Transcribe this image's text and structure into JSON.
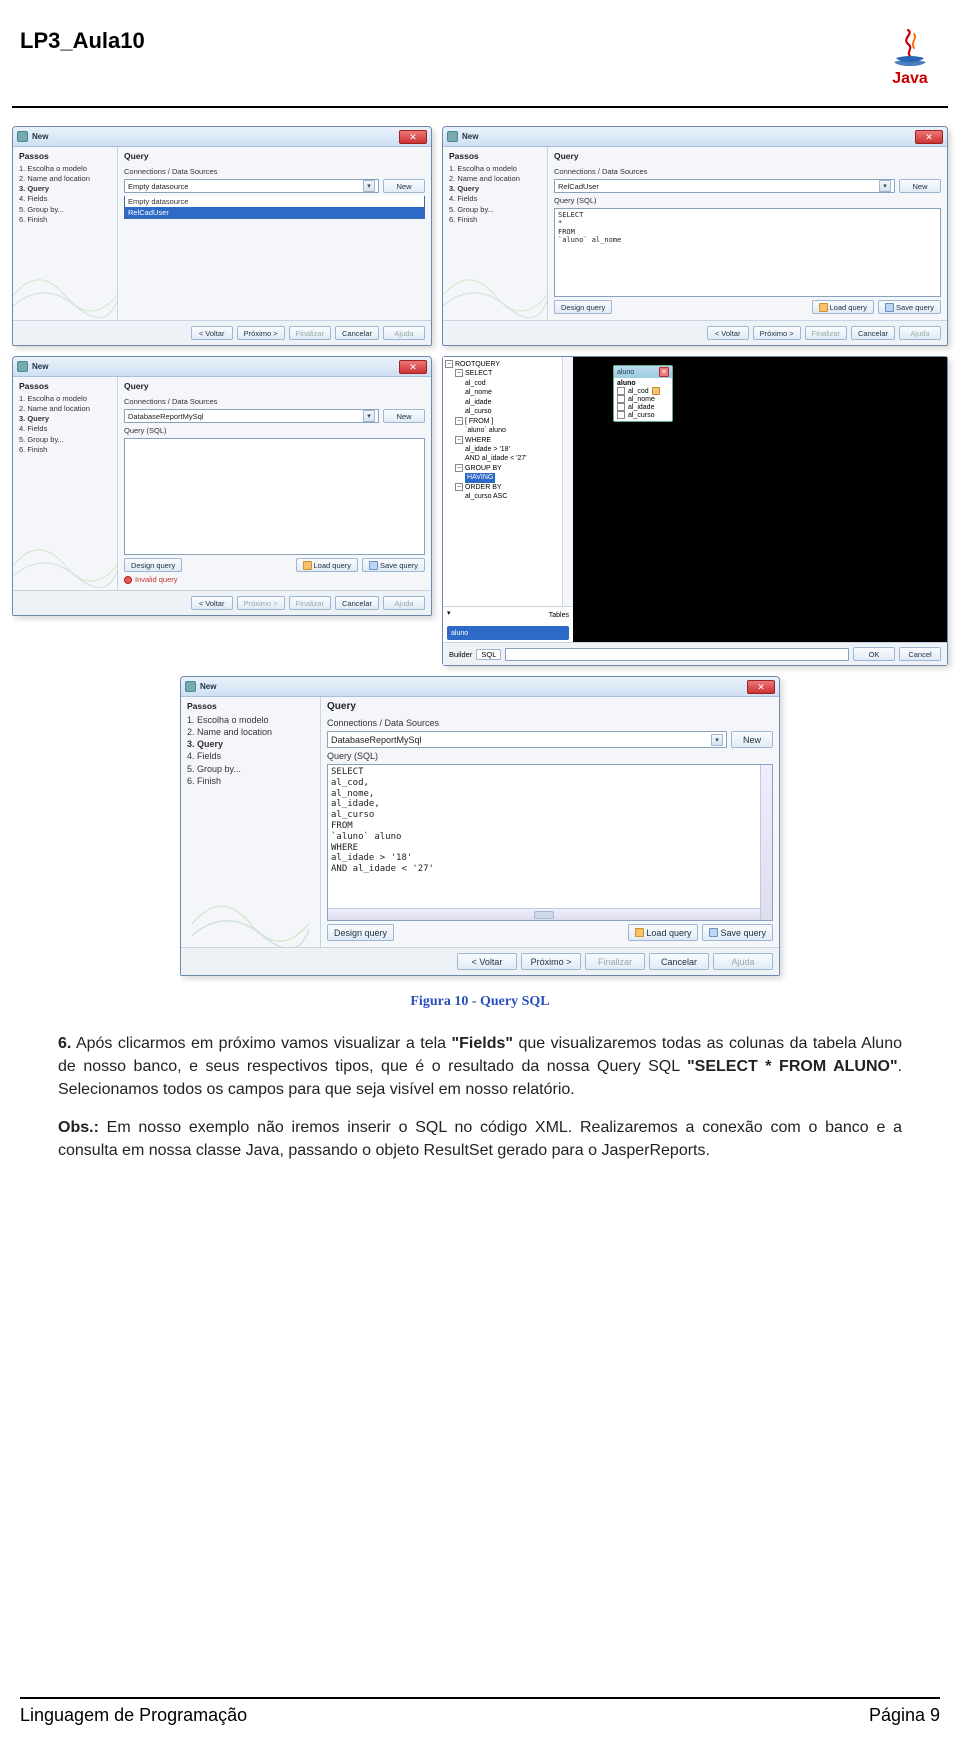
{
  "doc": {
    "title": "LP3_Aula10",
    "logo_text": "Java",
    "footer_left": "Linguagem de Programação",
    "footer_right": "Página 9"
  },
  "caption": "Figura 10 - Query SQL",
  "wizard": {
    "window_title": "New",
    "steps_header": "Passos",
    "right_header": "Query",
    "steps": [
      "Escolha o modelo",
      "Name and location",
      "Query",
      "Fields",
      "Group by...",
      "Finish"
    ],
    "steps_query_index": 2,
    "conn_label": "Connections / Data Sources",
    "new_btn": "New",
    "query_label": "Query (SQL)",
    "design_btn": "Design query",
    "load_btn": "Load query",
    "save_btn": "Save query",
    "invalid": "Invalid query",
    "nav": {
      "back": "< Voltar",
      "next": "Próximo >",
      "finish": "Finalizar",
      "cancel": "Cancelar",
      "help": "Ajuda"
    }
  },
  "dlg1": {
    "dd_selected": "Empty datasource",
    "options": [
      "Empty datasource",
      "RelCadUser"
    ]
  },
  "dlg2": {
    "dd_selected": "RelCadUser",
    "sql_lines": [
      "SELECT",
      "   *",
      "FROM",
      "   `aluno` al_nome"
    ]
  },
  "dlg3": {
    "dd_selected": "DatabaseReportMySql"
  },
  "dlg5": {
    "dd_selected": "DatabaseReportMySql",
    "sql_lines": [
      "SELECT",
      "   al_cod,",
      "   al_nome,",
      "   al_idade,",
      "   al_curso",
      "FROM",
      "   `aluno` aluno",
      "WHERE",
      "   al_idade > '18'",
      "   AND al_idade < '27'"
    ]
  },
  "qb": {
    "builder_label": "Builder",
    "sql_label": "SQL",
    "tables_label": "Tables",
    "table_bar": "aluno",
    "ok": "OK",
    "cancel": "Cancel",
    "tree": {
      "root": "ROOTQUERY",
      "select": "SELECT",
      "cols": [
        "al_cod",
        "al_nome",
        "al_idade",
        "al_curso"
      ],
      "from": "[ FROM ]",
      "from_item": "`aluno` aluno",
      "where": "WHERE",
      "where_items": [
        "al_idade > '18'",
        "AND al_idade < '27'"
      ],
      "groupby": "GROUP BY",
      "having": "HAVING",
      "orderby": "ORDER BY",
      "orderby_item": "al_curso ASC"
    },
    "float": {
      "title": "aluno",
      "subhead": "aluno",
      "fields": [
        "al_cod",
        "al_nome",
        "al_idade",
        "al_curso"
      ]
    }
  },
  "prose": {
    "p1_num": "6.",
    "p1_a": " Após clicarmos em próximo vamos visualizar a tela ",
    "p1_b": "\"Fields\"",
    "p1_c": " que visualizaremos todas as colunas da tabela Aluno de nosso banco, e seus respectivos tipos, que é o resultado da nossa Query SQL ",
    "p1_d": "\"SELECT * FROM ALUNO\"",
    "p1_e": ". Selecionamos todos os campos para que seja visível em nosso relatório.",
    "p2_a": "Obs.:",
    "p2_b": " Em nosso exemplo não iremos inserir o SQL no código XML. Realizaremos a conexão com o banco e a consulta em nossa classe Java, passando o objeto ResultSet gerado para o JasperReports."
  }
}
